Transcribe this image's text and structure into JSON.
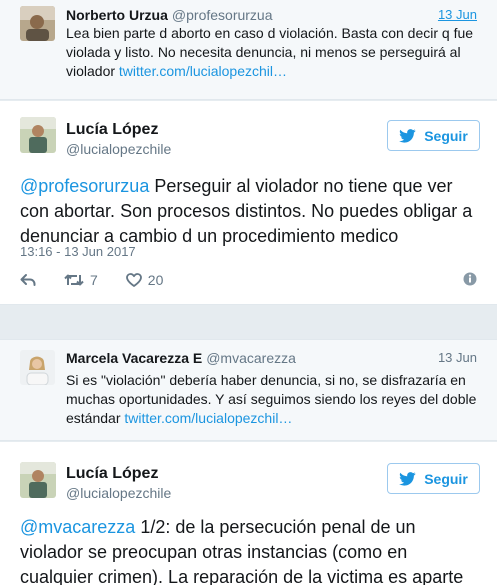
{
  "thread1": {
    "context": {
      "name": "Norberto Urzua",
      "handle": "@profesorurzua",
      "date": "13 Jun",
      "text": "Lea bien parte d aborto en caso d violación. Basta con decir q fue violada y listo. No necesita denuncia, ni menos se perseguirá al violador ",
      "link": "twitter.com/lucialopezchil…"
    },
    "reply": {
      "name": "Lucía López",
      "handle": "@lucialopezchile",
      "follow_label": "Seguir",
      "mention": "@profesorurzua",
      "text": " Perseguir al violador no tiene que ver con abortar. Son procesos distintos. No puedes obligar a denunciar a cambio d un procedimiento medico",
      "timestamp": "13:16 - 13 Jun 2017",
      "retweets": "7",
      "likes": "20"
    }
  },
  "thread2": {
    "context": {
      "name": "Marcela Vacarezza E",
      "handle": "@mvacarezza",
      "date": "13 Jun",
      "text": "Si es \"violación\" debería haber denuncia, si no, se disfrazaría en muchas oportunidades. Y así seguimos siendo los reyes del doble estándar ",
      "link": "twitter.com/lucialopezchil…"
    },
    "reply": {
      "name": "Lucía López",
      "handle": "@lucialopezchile",
      "follow_label": "Seguir",
      "mention": "@mvacarezza",
      "text": " 1/2: de la persecución penal de un violador se preocupan otras instancias (como en cualquier crimen). La reparación de la victima es aparte"
    }
  },
  "colors": {
    "link": "#1b95e0",
    "muted": "#657786",
    "background": "#e6ecf0"
  }
}
